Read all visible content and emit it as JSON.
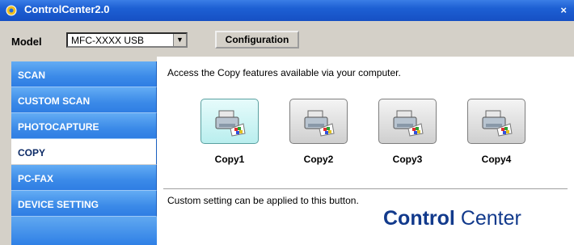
{
  "window": {
    "title": "ControlCenter2.0",
    "close_symbol": "×"
  },
  "model": {
    "label": "Model",
    "selected": "MFC-XXXX USB",
    "arrow": "▼"
  },
  "configuration_button": "Configuration",
  "sidebar": {
    "items": [
      {
        "label": "SCAN",
        "active": false
      },
      {
        "label": "CUSTOM SCAN",
        "active": false
      },
      {
        "label": "PHOTOCAPTURE",
        "active": false
      },
      {
        "label": "COPY",
        "active": true
      },
      {
        "label": "PC-FAX",
        "active": false
      },
      {
        "label": "DEVICE SETTING",
        "active": false
      }
    ]
  },
  "main": {
    "description": "Access the Copy features available via your computer.",
    "buttons": [
      {
        "label": "Copy1",
        "icon": "copy-printer-icon",
        "selected": true
      },
      {
        "label": "Copy2",
        "icon": "copy-printer-icon",
        "selected": false
      },
      {
        "label": "Copy3",
        "icon": "copy-printer-icon",
        "selected": false
      },
      {
        "label": "Copy4",
        "icon": "copy-printer-icon",
        "selected": false
      }
    ],
    "footer_text": "Custom setting can be applied to this button.",
    "logo": {
      "bold": "Control",
      "regular": " Center"
    }
  },
  "colors": {
    "title_bar": "#1d5fd3",
    "sidebar": "#3b8ae8",
    "logo": "#123a8c"
  }
}
